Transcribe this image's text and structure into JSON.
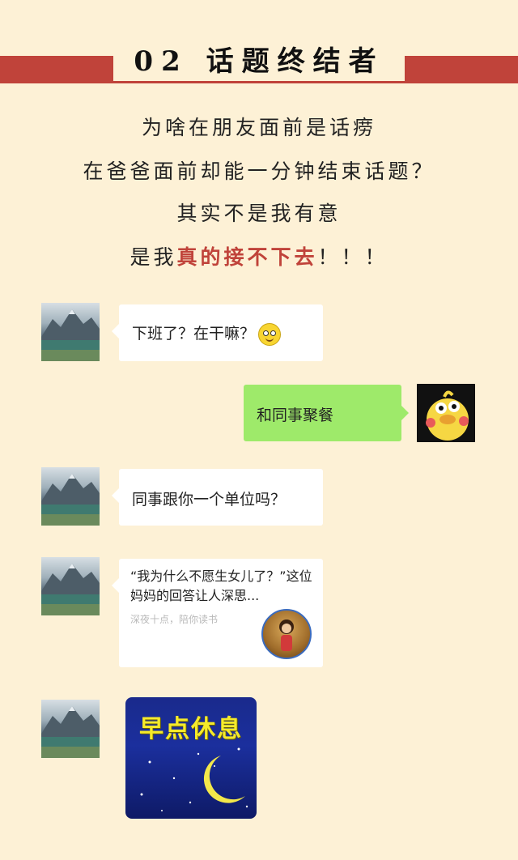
{
  "header": {
    "title": "02 话题终结者"
  },
  "intro": {
    "line1": "为啥在朋友面前是话痨",
    "line2": "在爸爸面前却能一分钟结束话题？",
    "line3": "其实不是我有意",
    "line4_prefix": "是我",
    "line4_highlight": "真的接不下去",
    "line4_suffix": "！！！"
  },
  "chat": {
    "msg1": "下班了？在干嘛？",
    "msg2": "和同事聚餐",
    "msg3": "同事跟你一个单位吗？",
    "card": {
      "title": "“我为什么不愿生女儿了？”这位妈妈的回答让人深思...",
      "source": "深夜十点，陪你读书"
    },
    "sticker_text": "早点休息"
  },
  "colors": {
    "background": "#fdf1d6",
    "banner": "#c0433a",
    "highlight": "#c0433a",
    "bubble_right": "#9eea6a"
  },
  "icons": {
    "smiley": "smiley-emoji-icon",
    "avatar_left": "mountain-lake-avatar",
    "avatar_right": "yellow-duck-avatar",
    "moon": "crescent-moon-icon"
  }
}
